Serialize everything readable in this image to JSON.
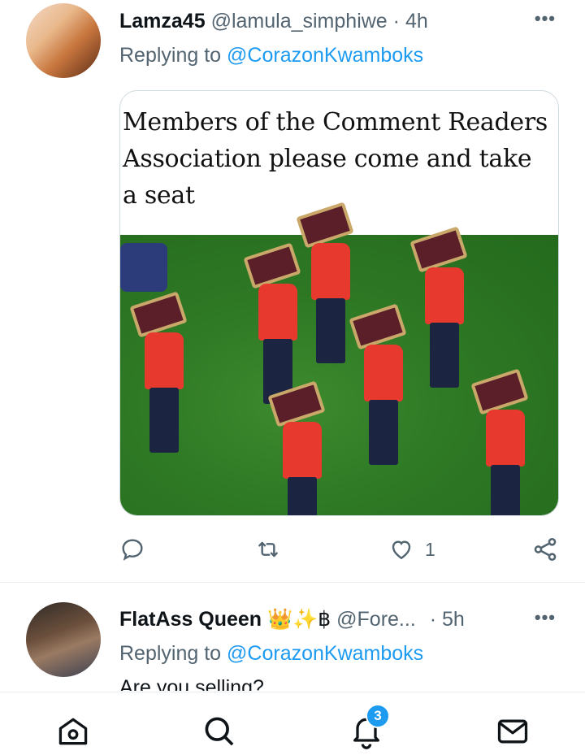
{
  "tweet1": {
    "display_name": "Lamza45",
    "handle": "@lamula_simphiwe",
    "separator": "·",
    "time": "4h",
    "replying_prefix": "Replying to",
    "replying_to": "@CorazonKwamboks",
    "media_text": "Members of the Comment Readers Association please come and take a seat",
    "like_count": "1"
  },
  "tweet2": {
    "display_name": "FlatAss Queen",
    "name_emoji": "👑✨฿",
    "handle": "@Fore...",
    "separator": "·",
    "time": "5h",
    "replying_prefix": "Replying to",
    "replying_to": "@CorazonKwamboks",
    "text": "Are you selling?"
  },
  "nav": {
    "notifications_badge": "3"
  },
  "colors": {
    "accent": "#1d9bf0",
    "muted": "#536471",
    "text": "#0f1419"
  }
}
